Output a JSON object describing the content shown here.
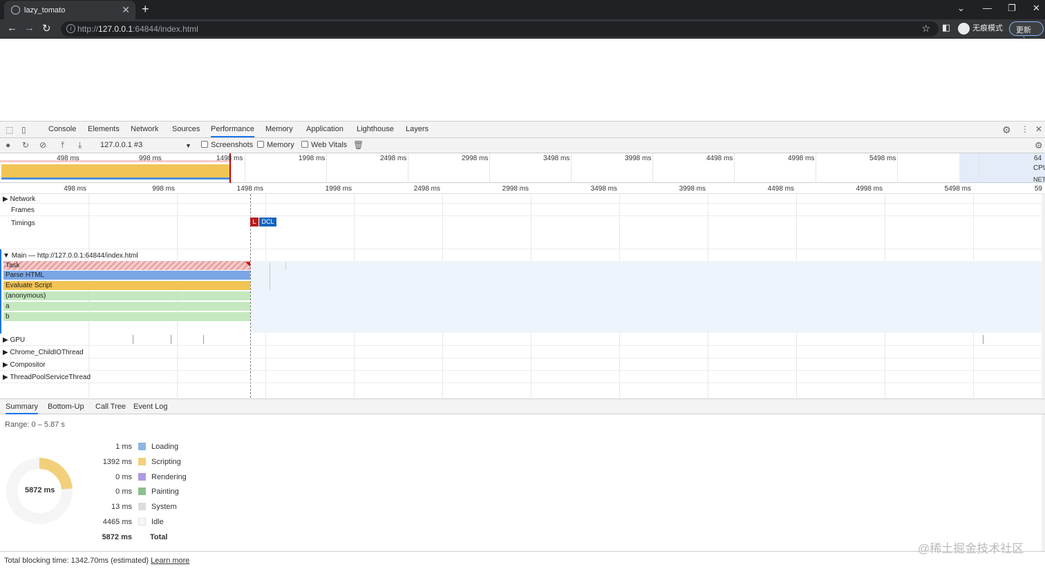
{
  "browser": {
    "tab_title": "lazy_tomato",
    "url_prefix": "http://",
    "url_host": "127.0.0.1",
    "url_rest": ":64844/index.html",
    "incognito_label": "无痕模式",
    "update_label": "更新"
  },
  "devtools": {
    "tabs": [
      "Console",
      "Elements",
      "Network",
      "Sources",
      "Performance",
      "Memory",
      "Application",
      "Lighthouse",
      "Layers"
    ],
    "active_tab": "Performance",
    "toolbar": {
      "profile_select": "127.0.0.1 #3",
      "screenshots_label": "Screenshots",
      "memory_label": "Memory",
      "webvitals_label": "Web Vitals"
    },
    "overview_ticks": [
      "498 ms",
      "998 ms",
      "1498 ms",
      "1998 ms",
      "2498 ms",
      "2998 ms",
      "3498 ms",
      "3998 ms",
      "4498 ms",
      "4998 ms",
      "5498 ms",
      "64"
    ],
    "overview_side": [
      "CPU",
      "NET"
    ],
    "ruler_ticks": [
      "498 ms",
      "998 ms",
      "1498 ms",
      "1998 ms",
      "2498 ms",
      "2998 ms",
      "3498 ms",
      "3998 ms",
      "4498 ms",
      "4998 ms",
      "5498 ms",
      "59"
    ],
    "tracks": {
      "network": "Network",
      "frames": "Frames",
      "timings": "Timings",
      "marker_l": "L",
      "marker_dcl": "DCL",
      "main": "Main — http://127.0.0.1:64844/index.html",
      "gpu": "GPU",
      "childio": "Chrome_ChildIOThread",
      "compositor": "Compositor",
      "threadpool": "ThreadPoolServiceThread"
    },
    "flame": [
      "Task",
      "Parse HTML",
      "Evaluate Script",
      "(anonymous)",
      "a",
      "b"
    ],
    "bottom_tabs": [
      "Summary",
      "Bottom-Up",
      "Call Tree",
      "Event Log"
    ],
    "summary": {
      "range": "Range: 0 – 5.87 s",
      "donut_total": "5872 ms",
      "rows": [
        {
          "value": "1 ms",
          "label": "Loading",
          "color": "#8fb4e3"
        },
        {
          "value": "1392 ms",
          "label": "Scripting",
          "color": "#f2d07b"
        },
        {
          "value": "0 ms",
          "label": "Rendering",
          "color": "#af9ae3"
        },
        {
          "value": "0 ms",
          "label": "Painting",
          "color": "#8cc08c"
        },
        {
          "value": "13 ms",
          "label": "System",
          "color": "#dcdcdc"
        },
        {
          "value": "4465 ms",
          "label": "Idle",
          "color": "#f7f7f7"
        },
        {
          "value": "5872 ms",
          "label": "Total",
          "color": ""
        }
      ],
      "scripting_fraction": 0.237,
      "system_fraction": 0.002
    },
    "status": {
      "text": "Total blocking time: 1342.70ms (estimated)",
      "link": "Learn more"
    }
  },
  "watermark": "@稀土掘金技术社区"
}
